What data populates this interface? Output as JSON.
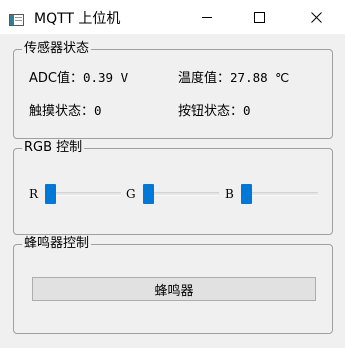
{
  "window": {
    "title": "MQTT 上位机",
    "icon": "app-window-icon",
    "controls": [
      "minimize-icon",
      "maximize-icon",
      "close-icon"
    ]
  },
  "sensor_group": {
    "title": "传感器状态",
    "adc_label": "ADC值：",
    "adc_value": "0.39 V",
    "temp_label": "温度值：",
    "temp_value": "27.88 ℃",
    "touch_label": "触摸状态：",
    "touch_value": "0",
    "key_label": "按钮状态：",
    "key_value": "0"
  },
  "rgb_group": {
    "title": "RGB 控制",
    "sliders": [
      {
        "label": "R",
        "value": 0
      },
      {
        "label": "G",
        "value": 0
      },
      {
        "label": "B",
        "value": 0
      }
    ],
    "handle_color": "#0078d7"
  },
  "buzzer_group": {
    "title": "蜂鸣器控制",
    "button_label": "蜂鸣器"
  }
}
